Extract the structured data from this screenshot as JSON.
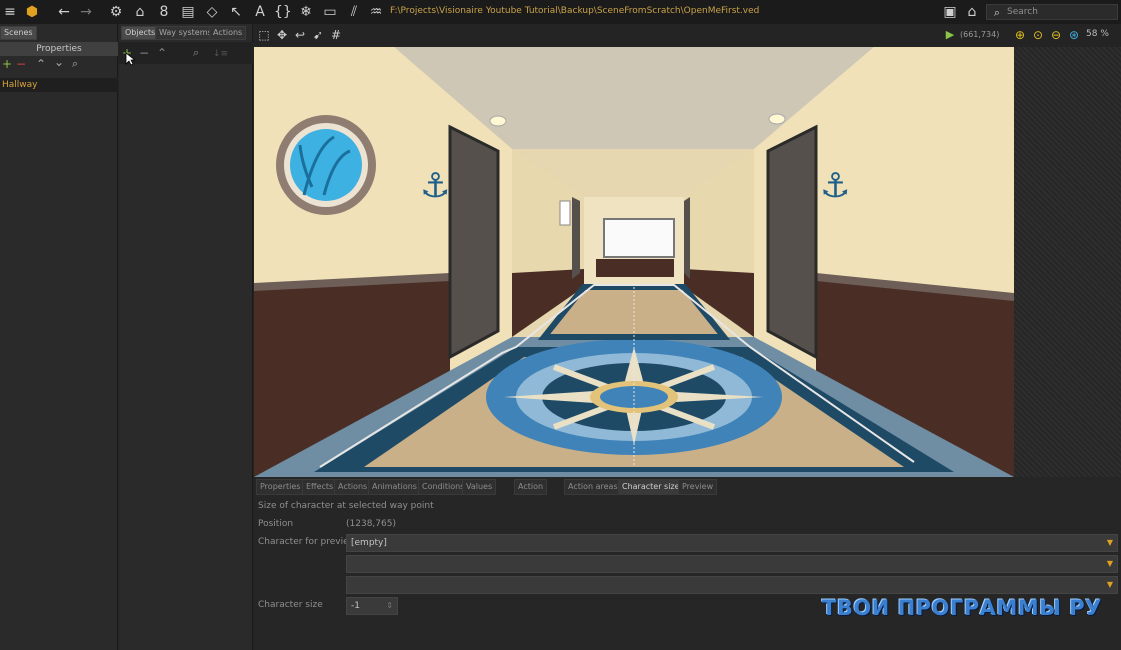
{
  "toolbar": {
    "path": "F:\\Projects\\Visionaire Youtube Tutorial\\Backup\\SceneFromScratch\\OpenMeFirst.ved",
    "search_placeholder": "Search"
  },
  "scenes_panel": {
    "tab": "Scenes",
    "properties": "Properties",
    "items": [
      "Hallway"
    ]
  },
  "objects_panel": {
    "tabs": [
      "Objects",
      "Way systems",
      "Actions"
    ]
  },
  "view": {
    "coords": "(661,734)",
    "zoom": "58 %"
  },
  "bottom_panel": {
    "tabs": [
      "Properties",
      "Effects",
      "Actions",
      "Animations",
      "Conditions",
      "Values",
      "Action",
      "Action areas",
      "Character size",
      "Preview"
    ],
    "active_tab": "Character size",
    "description": "Size of character at selected way point",
    "position_label": "Position",
    "position_value": "(1238,765)",
    "char_preview_label": "Character for preview",
    "char_preview_value": "[empty]",
    "char_size_label": "Character size",
    "char_size_value": "-1"
  },
  "watermark": "ТВОИ ПРОГРАММЫ РУ",
  "colors": {
    "accent": "#d8a33a",
    "link_green": "#8bc34a",
    "zoom_icons": "#e0c020"
  }
}
